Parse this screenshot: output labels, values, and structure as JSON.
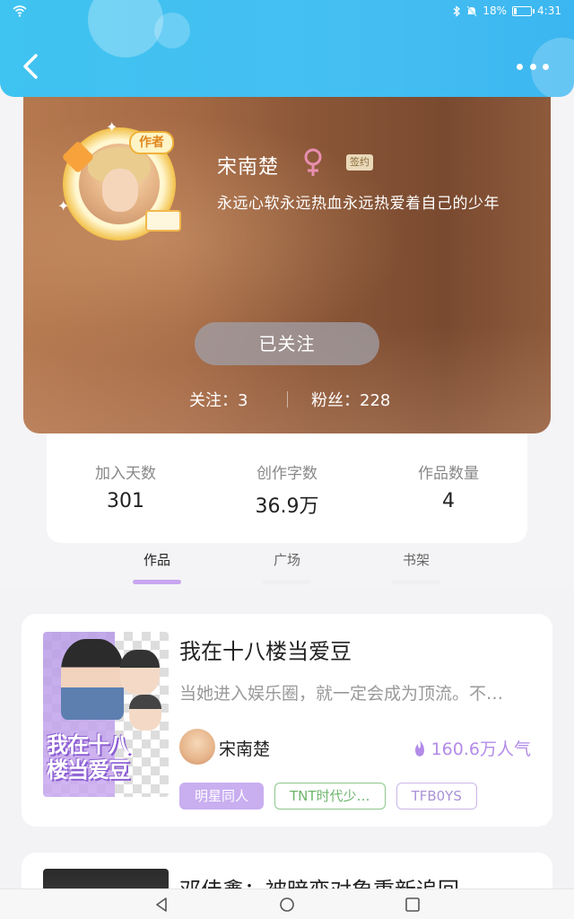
{
  "status_bar": {
    "battery": "18%",
    "battery_level": 0.18,
    "time": "4:31"
  },
  "profile": {
    "name": "宋南楚",
    "author_badge": "作者",
    "sign_badge": "签约",
    "bio": "永远心软永远热血永远热爱着自己的少年",
    "follow_button": "已关注",
    "following": "关注：3",
    "fans": "粉丝：228"
  },
  "stats": [
    {
      "label": "加入天数",
      "value": "301"
    },
    {
      "label": "创作字数",
      "value": "36.9万"
    },
    {
      "label": "作品数量",
      "value": "4"
    }
  ],
  "tabs": [
    {
      "label": "作品",
      "active": true
    },
    {
      "label": "广场",
      "active": false
    },
    {
      "label": "书架",
      "active": false
    }
  ],
  "works": [
    {
      "title": "我在十八楼当爱豆",
      "description": "当她进入娱乐圈，就一定会成为顶流。不…",
      "cover_text": "我在十八楼当爱豆",
      "author": "宋南楚",
      "heat": "160.6万人气",
      "tags": [
        "明星同人",
        "TNT时代少…",
        "TFB0YS"
      ]
    },
    {
      "title": "邓佳鑫：被暗恋对象重新追回"
    }
  ],
  "colors": {
    "header": "#45bff2",
    "accent_purple": "#c9a6f0",
    "heat_purple": "#b38be8",
    "tag_green": "#6db56b",
    "gender_pink": "#e88fb0"
  },
  "icons": {
    "back": "chevron-left-icon",
    "more": "more-dots-icon",
    "gender": "female-icon",
    "heat": "flame-icon",
    "nav_back": "triangle-back-icon",
    "nav_home": "circle-home-icon",
    "nav_recent": "square-recent-icon"
  }
}
